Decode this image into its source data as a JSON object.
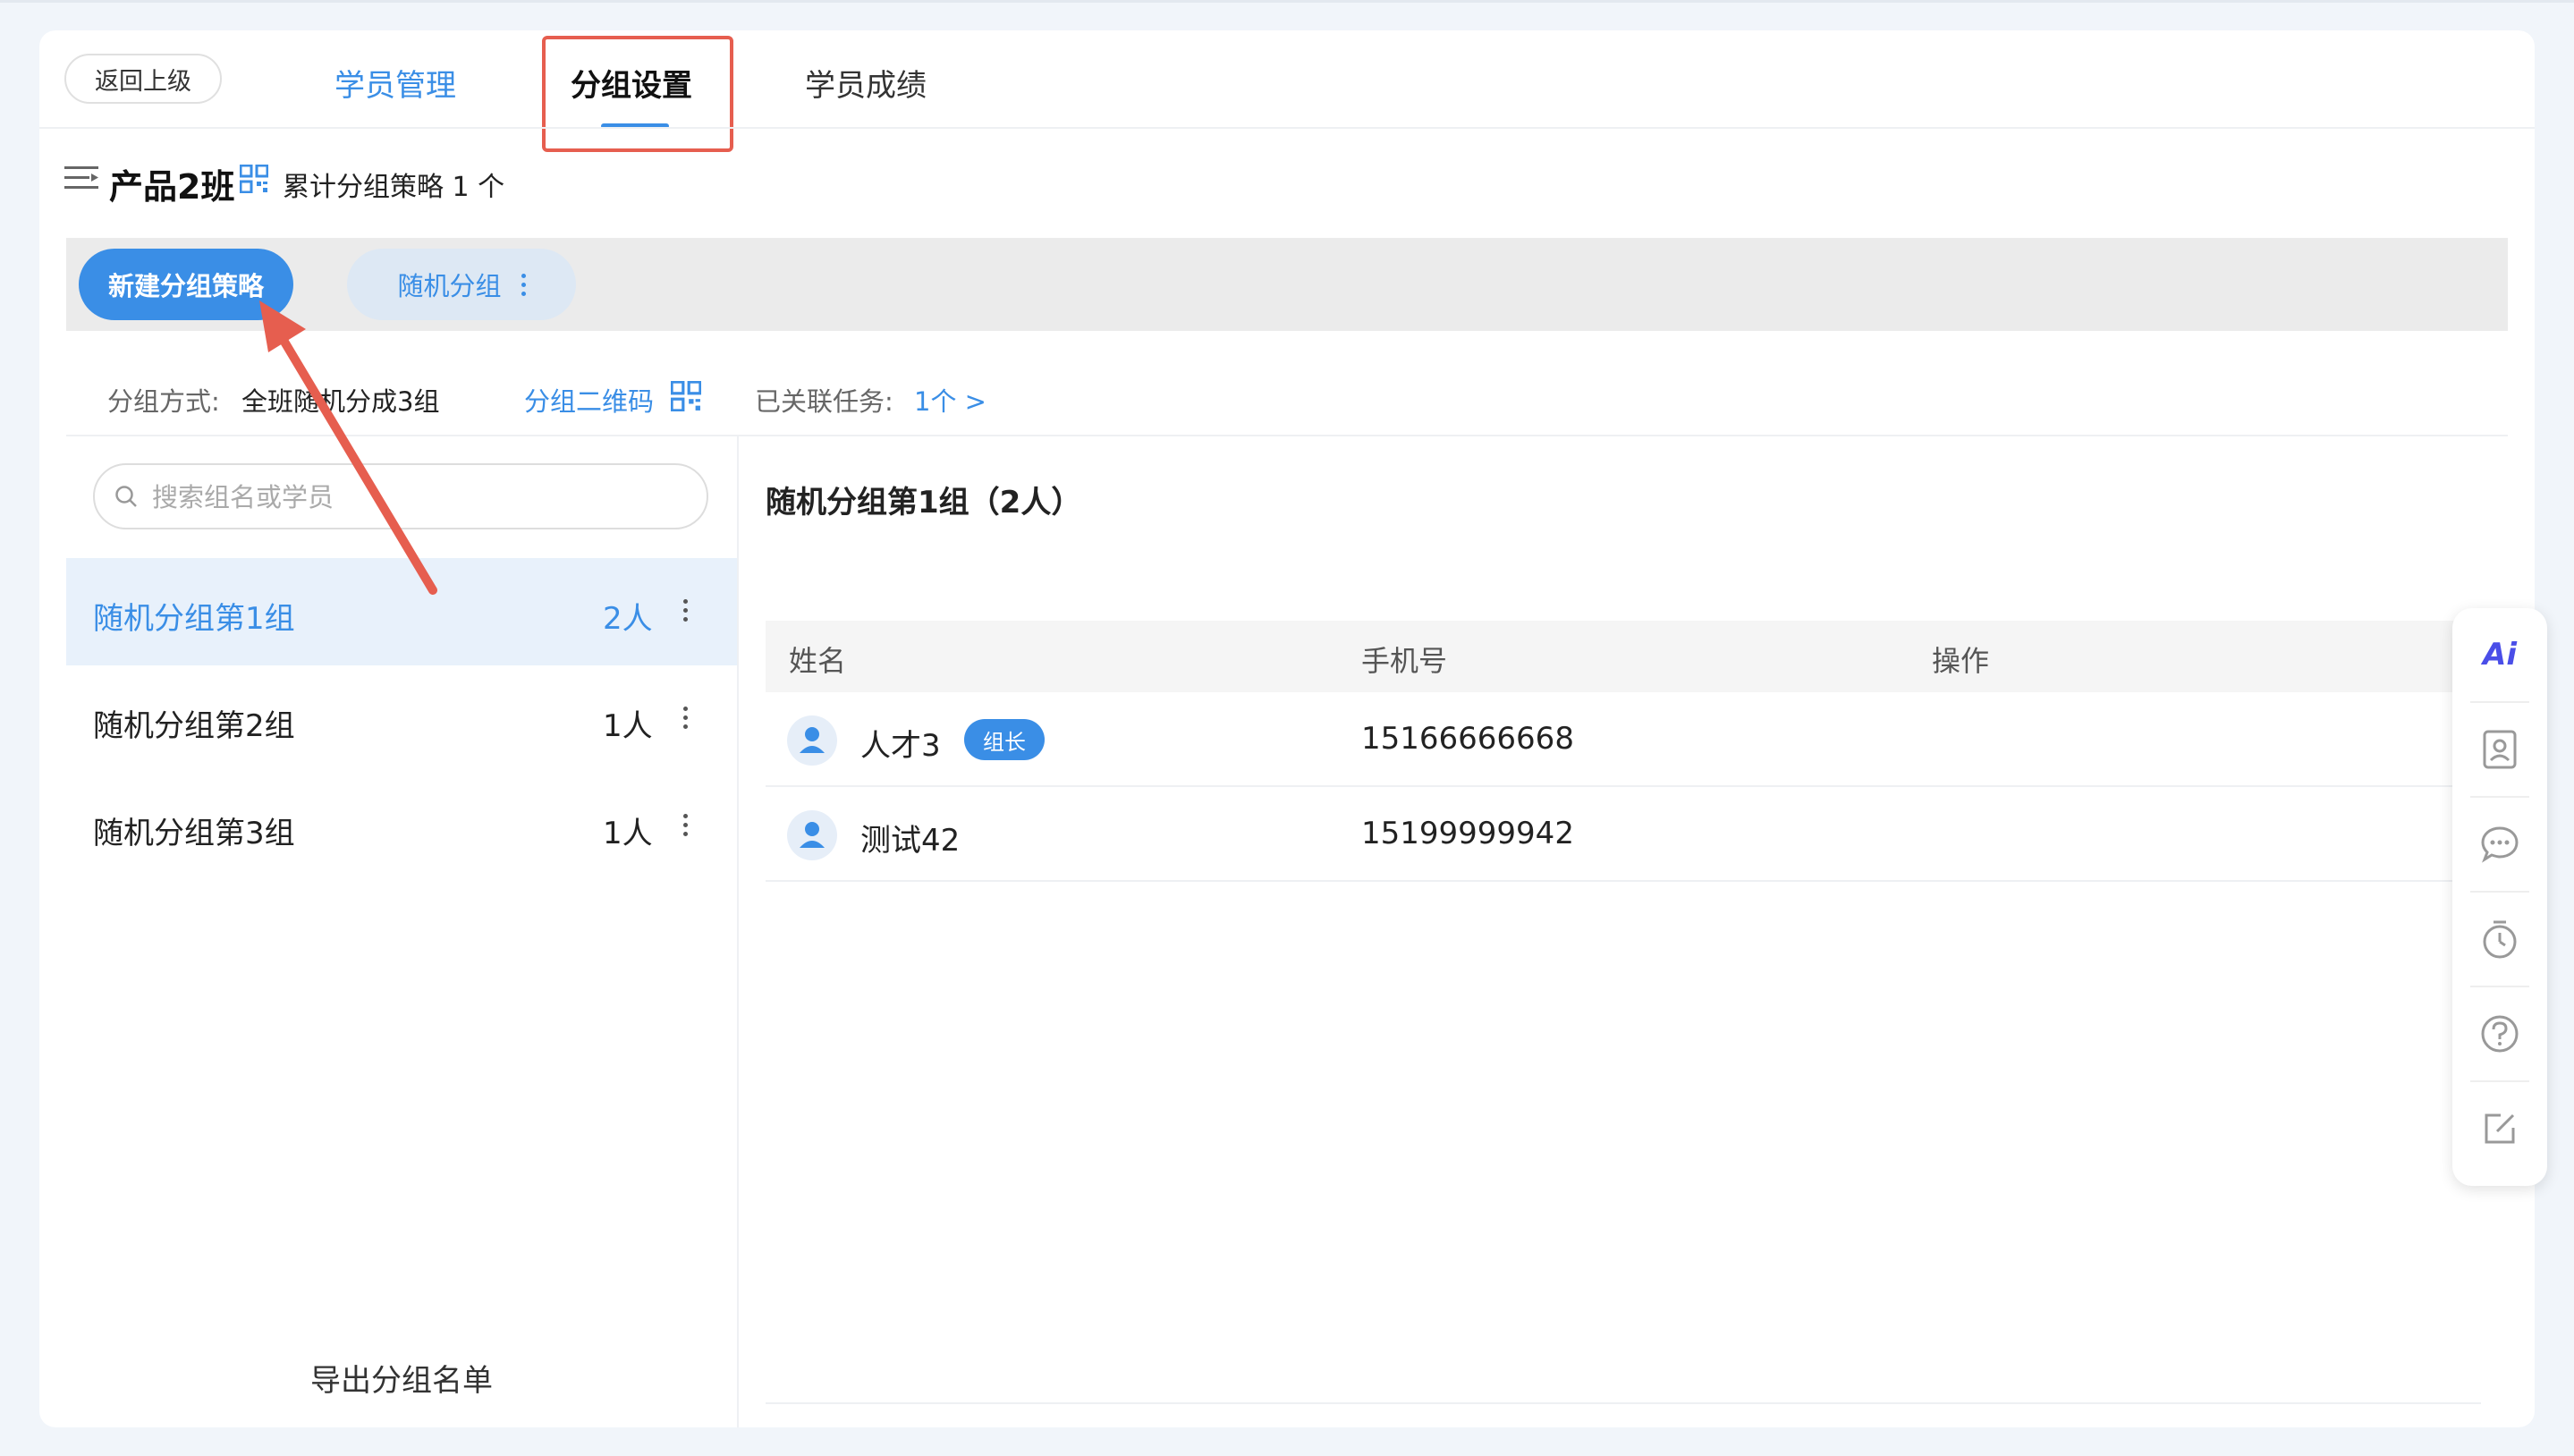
{
  "header": {
    "back_label": "返回上级",
    "tabs": [
      {
        "label": "学员管理"
      },
      {
        "label": "分组设置"
      },
      {
        "label": "学员成绩"
      }
    ]
  },
  "class_info": {
    "name": "产品2班",
    "strategy_count": "累计分组策略 1 个"
  },
  "strategy_bar": {
    "new_label": "新建分组策略",
    "chip_label": "随机分组"
  },
  "info": {
    "method_label": "分组方式:",
    "method_value": "全班随机分成3组",
    "qr_label": "分组二维码",
    "task_label": "已关联任务:",
    "task_value": "1个 >"
  },
  "left_panel": {
    "search_placeholder": "搜索组名或学员",
    "groups": [
      {
        "name": "随机分组第1组",
        "count": "2人"
      },
      {
        "name": "随机分组第2组",
        "count": "1人"
      },
      {
        "name": "随机分组第3组",
        "count": "1人"
      }
    ],
    "export_label": "导出分组名单"
  },
  "right_panel": {
    "title": "随机分组第1组（2人）",
    "columns": [
      "姓名",
      "手机号",
      "操作"
    ],
    "rows": [
      {
        "name": "人才3",
        "badge": "组长",
        "phone": "15166666668"
      },
      {
        "name": "测试42",
        "badge": "",
        "phone": "15199999942"
      }
    ]
  },
  "side_toolbar": {
    "ai_label": "Ai"
  },
  "colors": {
    "accent": "#3a8ee6",
    "highlight": "#e65e4f"
  }
}
